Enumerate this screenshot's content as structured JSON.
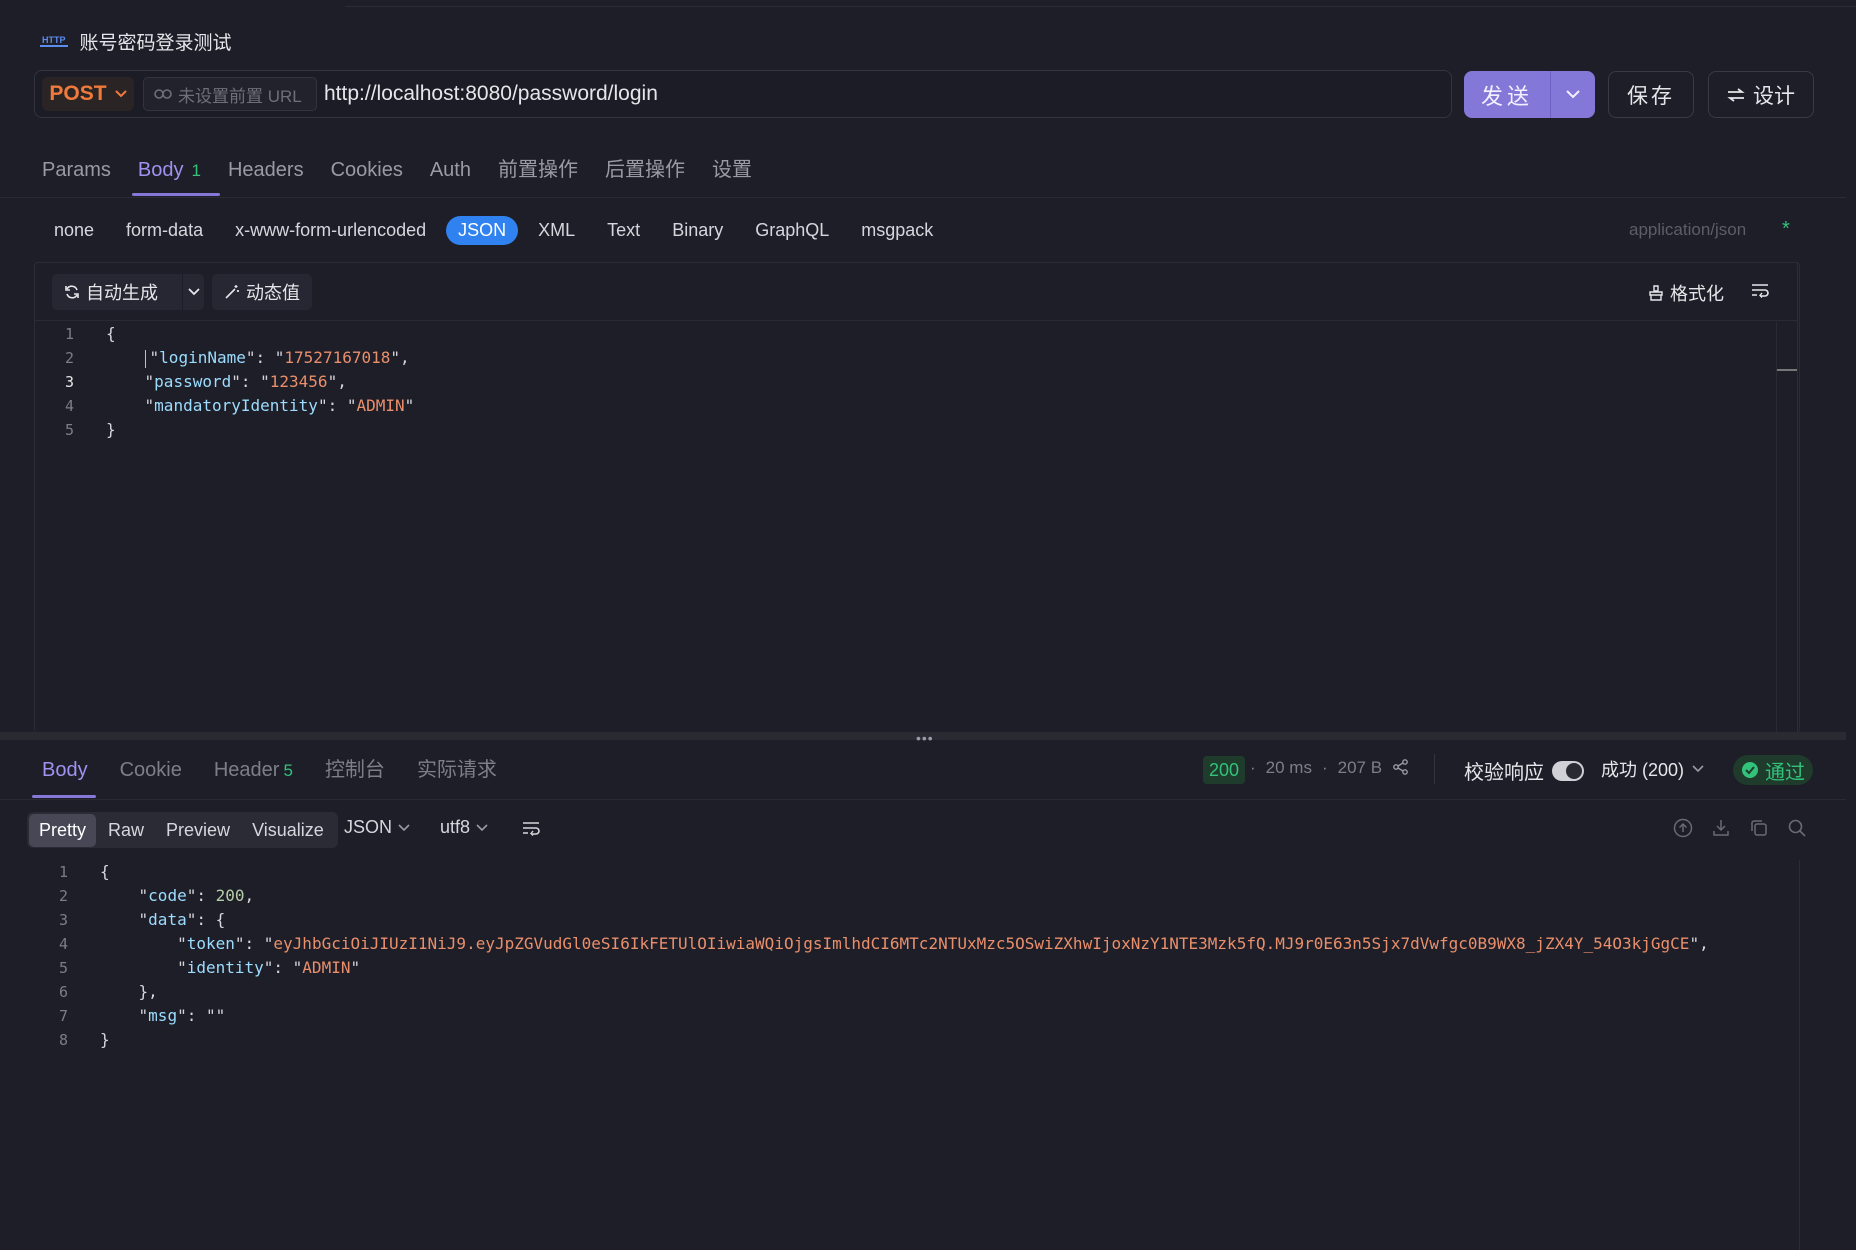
{
  "title": {
    "badge": "HTTP",
    "text": "账号密码登录测试"
  },
  "request": {
    "method": "POST",
    "prefix_placeholder": "未设置前置 URL",
    "url": "http://localhost:8080/password/login",
    "send_label": "发送",
    "save_label": "保存",
    "design_label": "设计"
  },
  "req_tabs": [
    {
      "label": "Params"
    },
    {
      "label": "Body",
      "count": "1"
    },
    {
      "label": "Headers"
    },
    {
      "label": "Cookies"
    },
    {
      "label": "Auth"
    },
    {
      "label": "前置操作"
    },
    {
      "label": "后置操作"
    },
    {
      "label": "设置"
    }
  ],
  "body_types": [
    "none",
    "form-data",
    "x-www-form-urlencoded",
    "JSON",
    "XML",
    "Text",
    "Binary",
    "GraphQL",
    "msgpack"
  ],
  "body_active": "JSON",
  "content_type": "application/json",
  "required_mark": "*",
  "editor": {
    "autogen_label": "自动生成",
    "dynamic_label": "动态值",
    "format_label": "格式化",
    "line_numbers": [
      "1",
      "2",
      "3",
      "4",
      "5"
    ],
    "request_json": {
      "loginName": "17527167018",
      "password": "123456",
      "mandatoryIdentity": "ADMIN"
    }
  },
  "res_tabs": [
    {
      "label": "Body"
    },
    {
      "label": "Cookie"
    },
    {
      "label": "Header",
      "count": "5"
    },
    {
      "label": "控制台"
    },
    {
      "label": "实际请求"
    }
  ],
  "status": {
    "code": "200",
    "time": "20 ms",
    "size": "207 B",
    "validate_label": "校验响应",
    "result_select": "成功 (200)",
    "pass_label": "通过"
  },
  "views": [
    "Pretty",
    "Raw",
    "Preview",
    "Visualize"
  ],
  "view_active": "Pretty",
  "format_select": "JSON",
  "encoding_select": "utf8",
  "response": {
    "line_numbers": [
      "1",
      "2",
      "3",
      "4",
      "5",
      "6",
      "7",
      "8"
    ],
    "code": "200",
    "token": "eyJhbGciOiJIUzI1NiJ9.eyJpZGVudGl0eSI6IkFETUlOIiwiaWQiOjgsImlhdCI6MTc2NTUxMzc5OSwiZXhwIjoxNzY1NTE3Mzk5fQ.MJ9r0E63n5Sjx7dVwfgc0B9WX8_jZX4Y_54O3kjGgCE",
    "identity": "ADMIN",
    "msg": ""
  },
  "icons": [
    "http-icon",
    "link-icon",
    "chevron-down-icon",
    "sync-icon",
    "magic-wand-icon",
    "broom-icon",
    "wrap-icon",
    "share-icon",
    "check-circle-icon",
    "upload-icon",
    "download-icon",
    "copy-icon",
    "search-icon",
    "design-icon"
  ]
}
